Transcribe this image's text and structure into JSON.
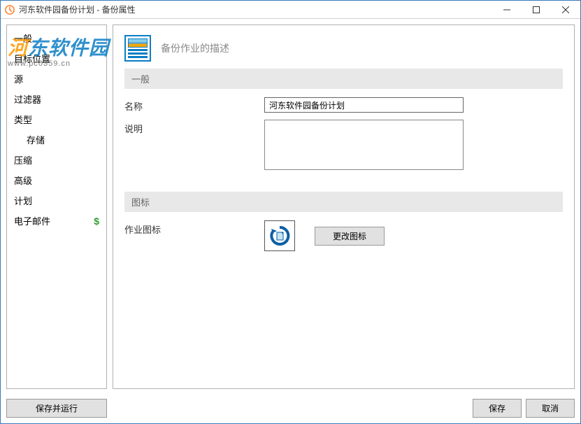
{
  "titlebar": {
    "title": "河东软件园备份计划 - 备份属性"
  },
  "watermark": {
    "brand": "河东软件园",
    "url": "www.pc0359.cn"
  },
  "sidebar": {
    "items": [
      {
        "label": "一般",
        "indent": false,
        "special": null
      },
      {
        "label": "目标位置",
        "indent": false,
        "special": null
      },
      {
        "label": "源",
        "indent": false,
        "special": null
      },
      {
        "label": "过滤器",
        "indent": false,
        "special": null
      },
      {
        "label": "类型",
        "indent": false,
        "special": null
      },
      {
        "label": "存储",
        "indent": true,
        "special": null
      },
      {
        "label": "压缩",
        "indent": false,
        "special": null
      },
      {
        "label": "高级",
        "indent": false,
        "special": null
      },
      {
        "label": "计划",
        "indent": false,
        "special": null
      },
      {
        "label": "电子邮件",
        "indent": false,
        "special": "dollar"
      }
    ]
  },
  "main": {
    "header_title": "备份作业的描述",
    "sections": {
      "general": {
        "title": "一般",
        "name_label": "名称",
        "name_value": "河东软件园备份计划",
        "desc_label": "说明",
        "desc_value": ""
      },
      "icon": {
        "title": "图标",
        "label": "作业图标",
        "change_button": "更改图标"
      }
    }
  },
  "footer": {
    "save_and_run": "保存并运行",
    "save": "保存",
    "cancel": "取消"
  }
}
